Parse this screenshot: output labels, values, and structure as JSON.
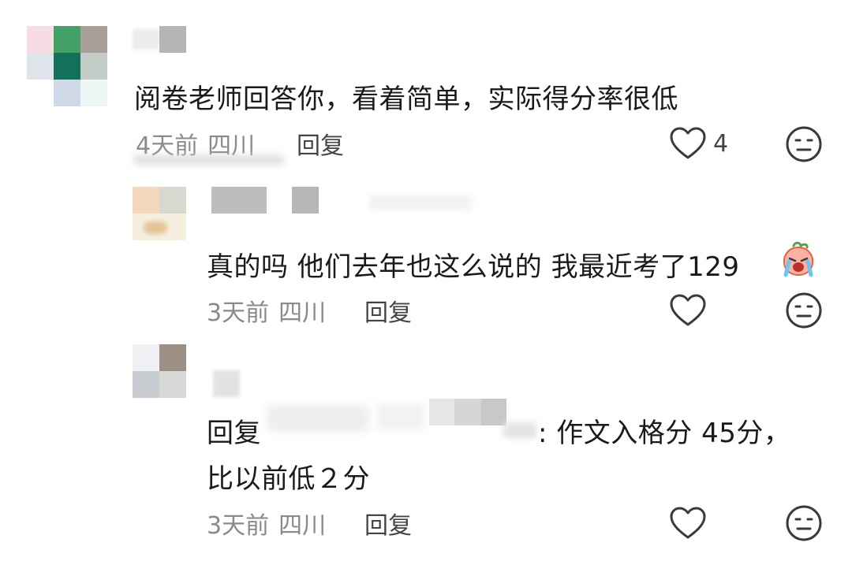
{
  "comments": [
    {
      "text": "阅卷老师回答你，看着简单，实际得分率很低",
      "time": "4天前",
      "location": "四川",
      "reply_label": "回复",
      "like_count": "4"
    },
    {
      "text": "真的吗 他们去年也这么说的 我最近考了129",
      "time": "3天前",
      "location": "四川",
      "reply_label": "回复",
      "like_count": ""
    },
    {
      "text_prefix": "回复",
      "text_line1_suffix": ": 作文入格分 45分，",
      "text_line2": "比以前低２分",
      "time": "3天前",
      "location": "四川",
      "reply_label": "回复",
      "like_count": ""
    }
  ],
  "icons": {
    "like": "heart-outline-icon",
    "dislike": "neutral-face-icon",
    "emoji": "crying-peach-emoji"
  },
  "colors": {
    "text": "#1a1a1a",
    "meta": "#8a8a8a",
    "icon": "#3a3a3a"
  }
}
